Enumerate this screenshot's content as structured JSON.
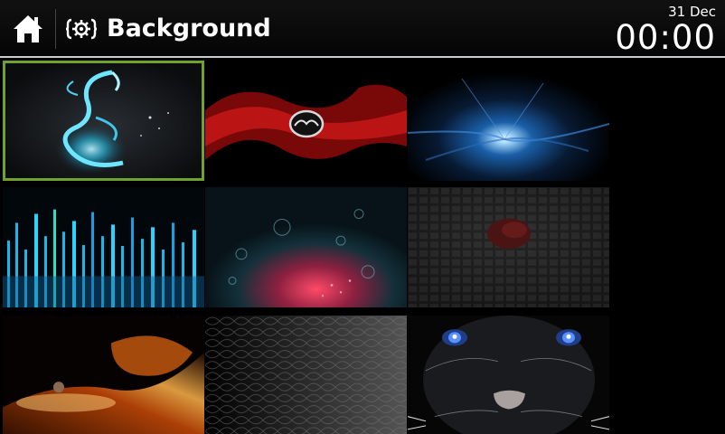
{
  "header": {
    "home_icon": "home-icon",
    "settings_icon": "settings-gear-icon",
    "title": "Background",
    "date": "31 Dec",
    "time": "00:00"
  },
  "wallpapers": [
    {
      "name": "dragon",
      "selected": true
    },
    {
      "name": "mazda-logo-red-fractal",
      "selected": false
    },
    {
      "name": "blue-starburst",
      "selected": false
    },
    {
      "name": "blue-light-bars",
      "selected": false
    },
    {
      "name": "red-bubbles",
      "selected": false
    },
    {
      "name": "dark-cubes-ladybug",
      "selected": false
    },
    {
      "name": "fiery-sky",
      "selected": false
    },
    {
      "name": "black-leather",
      "selected": false
    },
    {
      "name": "panther-face",
      "selected": false
    }
  ],
  "colors": {
    "selection_border": "#6fa32b",
    "header_underline": "#c9cdd0"
  }
}
